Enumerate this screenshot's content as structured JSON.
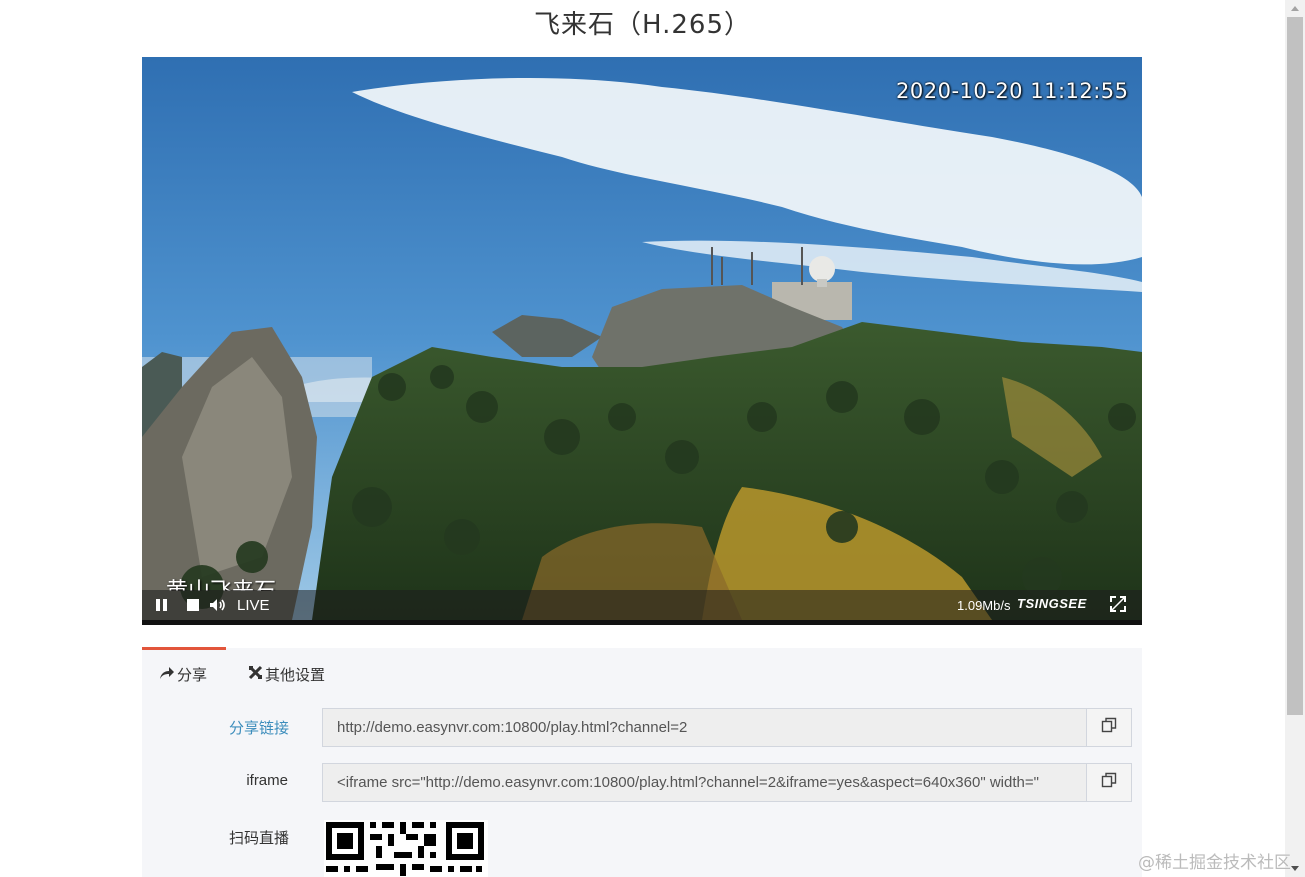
{
  "page": {
    "title": "飞来石（H.265）"
  },
  "player": {
    "osd_timestamp": "2020-10-20 11:12:55",
    "osd_channel_name": "黄山飞来石",
    "live_label": "LIVE",
    "bitrate": "1.09Mb/s",
    "brand": "TSINGSEE",
    "controls": [
      "pause-icon",
      "stop-icon",
      "volume-icon",
      "fullscreen-icon"
    ]
  },
  "tabs": [
    {
      "label": "分享",
      "icon": "share-icon",
      "active": true
    },
    {
      "label": "其他设置",
      "icon": "settings-icon",
      "active": false
    }
  ],
  "share": {
    "link_label": "分享链接",
    "link_value": "http://demo.easynvr.com:10800/play.html?channel=2",
    "iframe_label": "iframe",
    "iframe_value": "<iframe src=\"http://demo.easynvr.com:10800/play.html?channel=2&iframe=yes&aspect=640x360\" width=\"",
    "qr_label": "扫码直播"
  },
  "watermark": "@稀土掘金技术社区",
  "colors": {
    "accent_tab": "#e2553b",
    "link": "#3c8dbc",
    "panel_bg": "#f5f6f9"
  }
}
